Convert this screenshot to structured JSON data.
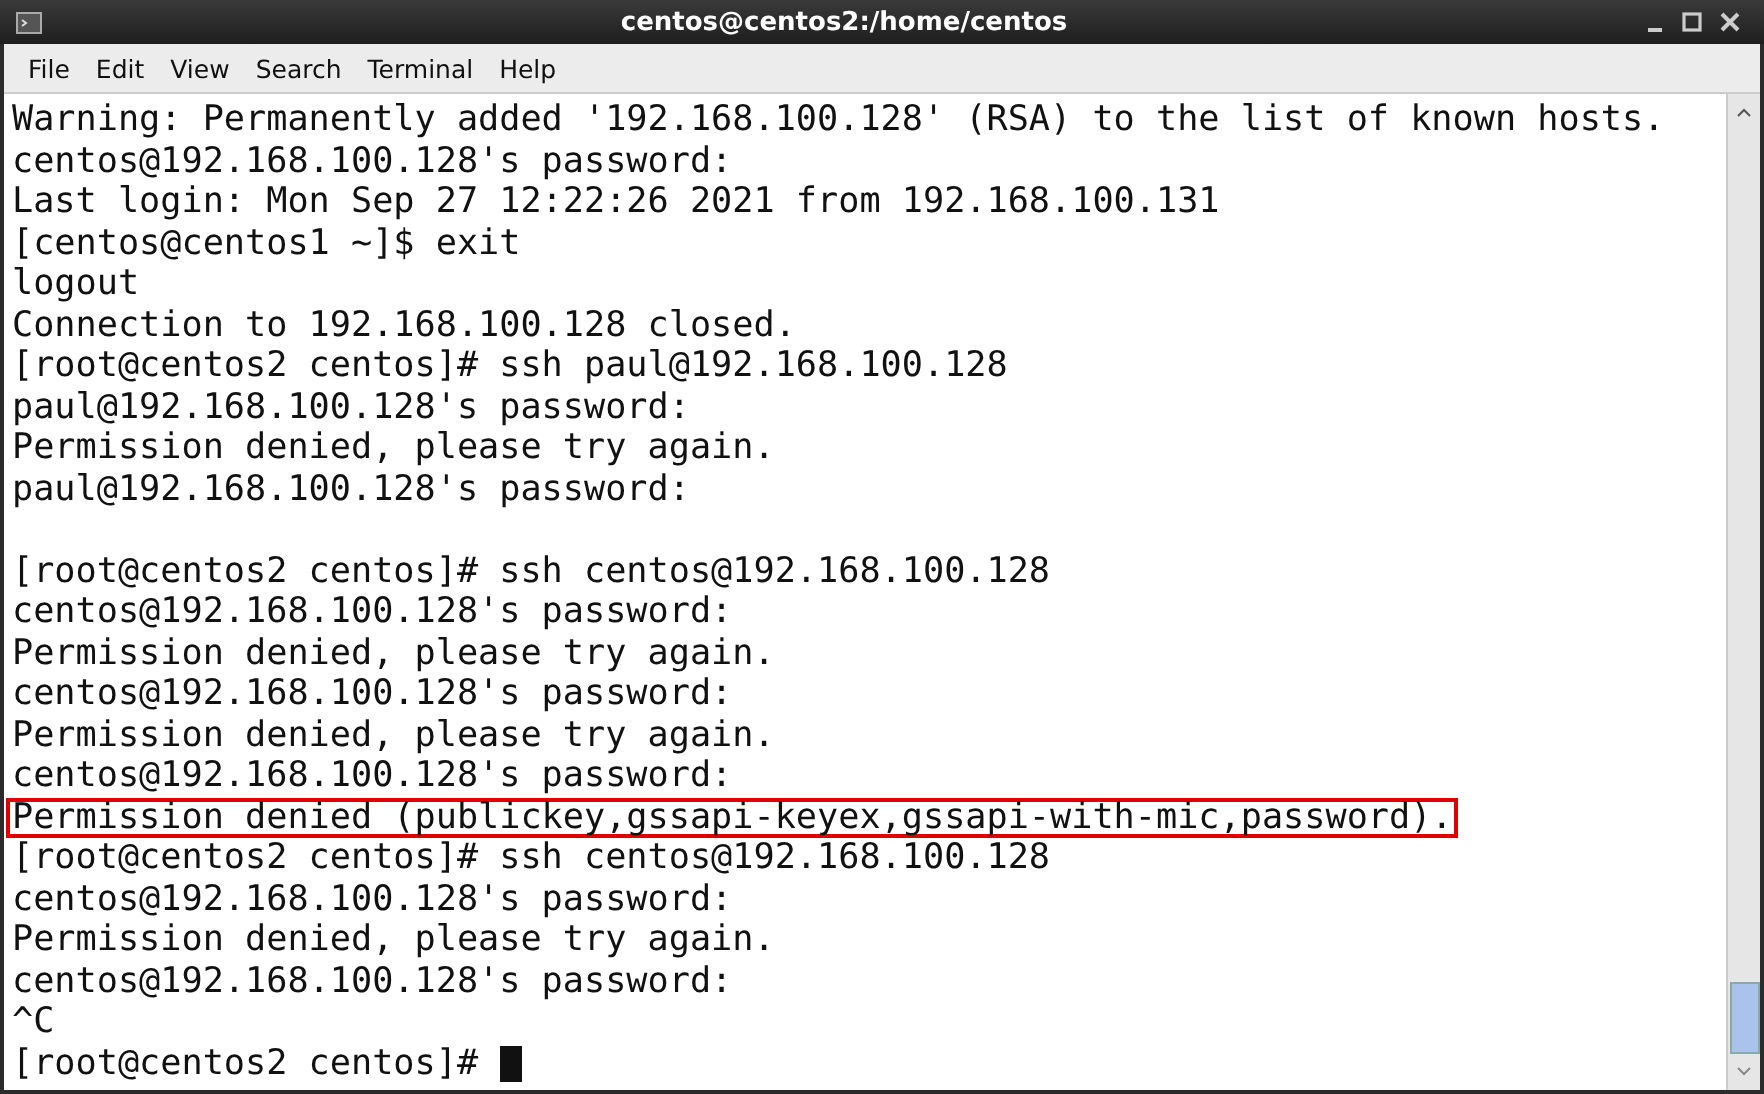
{
  "window": {
    "title": "centos@centos2:/home/centos"
  },
  "menu": [
    "File",
    "Edit",
    "View",
    "Search",
    "Terminal",
    "Help"
  ],
  "terminal": {
    "lines": [
      {
        "kind": "output",
        "text": "Warning: Permanently added '192.168.100.128' (RSA) to the list of known hosts.",
        "highlighted": false
      },
      {
        "kind": "output",
        "text": "centos@192.168.100.128's password:",
        "highlighted": false
      },
      {
        "kind": "output",
        "text": "Last login: Mon Sep 27 12:22:26 2021 from 192.168.100.131",
        "highlighted": false
      },
      {
        "kind": "output",
        "text": "[centos@centos1 ~]$ exit",
        "highlighted": false
      },
      {
        "kind": "output",
        "text": "logout",
        "highlighted": false
      },
      {
        "kind": "output",
        "text": "Connection to 192.168.100.128 closed.",
        "highlighted": false
      },
      {
        "kind": "output",
        "text": "[root@centos2 centos]# ssh paul@192.168.100.128",
        "highlighted": false
      },
      {
        "kind": "output",
        "text": "paul@192.168.100.128's password:",
        "highlighted": false
      },
      {
        "kind": "output",
        "text": "Permission denied, please try again.",
        "highlighted": false
      },
      {
        "kind": "output",
        "text": "paul@192.168.100.128's password:",
        "highlighted": false
      },
      {
        "kind": "blank",
        "highlighted": false
      },
      {
        "kind": "output",
        "text": "[root@centos2 centos]# ssh centos@192.168.100.128",
        "highlighted": false
      },
      {
        "kind": "output",
        "text": "centos@192.168.100.128's password:",
        "highlighted": false
      },
      {
        "kind": "output",
        "text": "Permission denied, please try again.",
        "highlighted": false
      },
      {
        "kind": "output",
        "text": "centos@192.168.100.128's password:",
        "highlighted": false
      },
      {
        "kind": "output",
        "text": "Permission denied, please try again.",
        "highlighted": false
      },
      {
        "kind": "output",
        "text": "centos@192.168.100.128's password:",
        "highlighted": false
      },
      {
        "kind": "output",
        "text": "Permission denied (publickey,gssapi-keyex,gssapi-with-mic,password).",
        "highlighted": true
      },
      {
        "kind": "output",
        "text": "[root@centos2 centos]# ssh centos@192.168.100.128",
        "highlighted": false
      },
      {
        "kind": "output",
        "text": "centos@192.168.100.128's password:",
        "highlighted": false
      },
      {
        "kind": "output",
        "text": "Permission denied, please try again.",
        "highlighted": false
      },
      {
        "kind": "output",
        "text": "centos@192.168.100.128's password:",
        "highlighted": false
      },
      {
        "kind": "output",
        "text": "^C",
        "highlighted": false
      }
    ],
    "prompt": {
      "text": "[root@centos2 centos]#",
      "cursor": true
    }
  }
}
